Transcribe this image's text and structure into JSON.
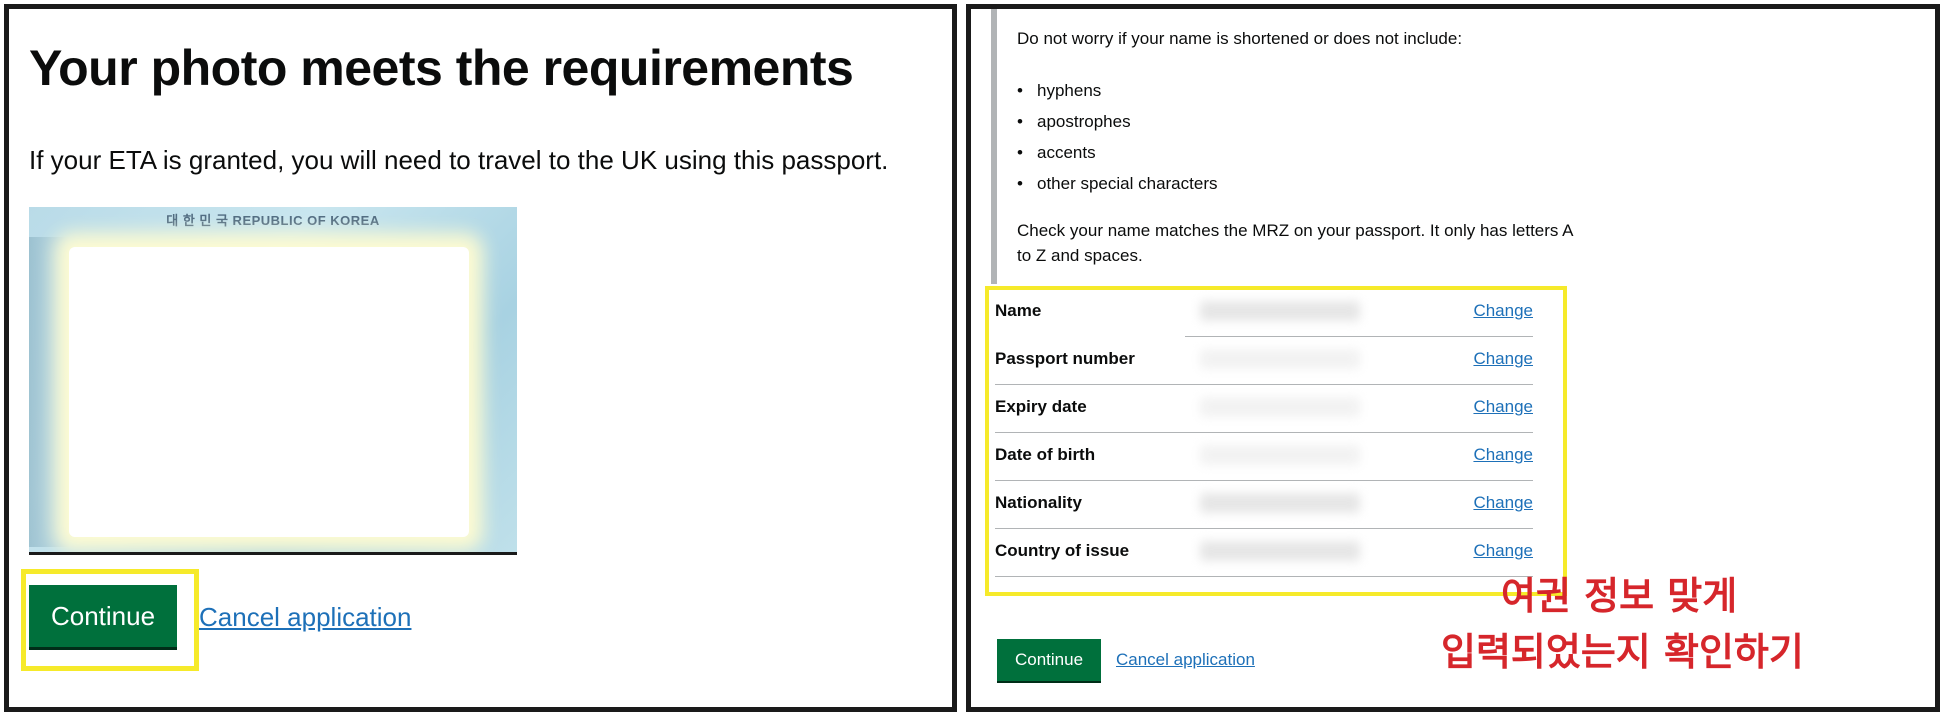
{
  "left": {
    "title": "Your photo meets the requirements",
    "lead": "If your ETA is granted, you will need to travel to the UK using this passport.",
    "passport_header": "대 한 민 국   REPUBLIC OF KOREA",
    "continue_label": "Continue",
    "cancel_label": "Cancel application"
  },
  "right": {
    "intro": "Do not worry if your name is shortened or does not include:",
    "bullets": [
      "hyphens",
      "apostrophes",
      "accents",
      "other special characters"
    ],
    "mrz_line1": "Check your name matches the MRZ on your passport. It only has letters A",
    "mrz_line2": "to Z and spaces.",
    "summary_rows": [
      {
        "key": "Name",
        "change": "Change"
      },
      {
        "key": "Passport number",
        "change": "Change"
      },
      {
        "key": "Expiry date",
        "change": "Change"
      },
      {
        "key": "Date of birth",
        "change": "Change"
      },
      {
        "key": "Nationality",
        "change": "Change"
      },
      {
        "key": "Country of issue",
        "change": "Change"
      }
    ],
    "annotation_line1": "여권 정보 맞게",
    "annotation_line2": "입력되었는지 확인하기",
    "continue_label": "Continue",
    "cancel_label": "Cancel application"
  },
  "colors": {
    "button_green": "#00703c",
    "link_blue": "#1d70b8",
    "highlight_yellow": "#f6ea2a",
    "annotation_red": "#d6262b"
  }
}
